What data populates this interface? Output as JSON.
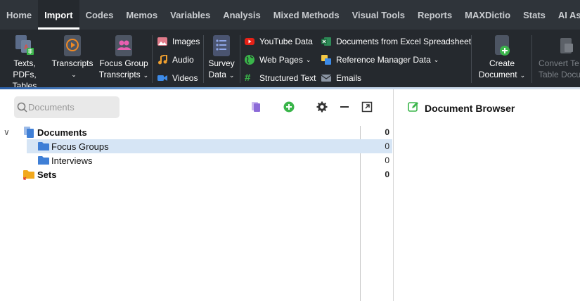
{
  "menu": {
    "tabs": [
      "Home",
      "Import",
      "Codes",
      "Memos",
      "Variables",
      "Analysis",
      "Mixed Methods",
      "Visual Tools",
      "Reports",
      "MAXDictio",
      "Stats",
      "AI Assist"
    ],
    "active": "Import"
  },
  "ribbon": {
    "texts_label_1": "Texts, PDFs,",
    "texts_label_2": "Tables",
    "transcripts_label": "Transcripts",
    "focus_label_1": "Focus Group",
    "focus_label_2": "Transcripts",
    "images": "Images",
    "audio": "Audio",
    "videos": "Videos",
    "survey_label_1": "Survey",
    "survey_label_2": "Data",
    "youtube": "YouTube Data",
    "webpages": "Web Pages",
    "structured": "Structured Text",
    "excel": "Documents from Excel Spreadsheet",
    "refmanager": "Reference Manager Data",
    "emails": "Emails",
    "create_label_1": "Create",
    "create_label_2": "Document",
    "convert_label_1": "Convert Te",
    "convert_label_2": "Table Docu"
  },
  "colors": {
    "menubar": "#2f343a",
    "ribbon": "#25292e",
    "selection": "#d6e5f5",
    "folder_blue": "#3f7fd6",
    "sets_orange": "#f2a91d",
    "add_green": "#3ab54a"
  },
  "documents": {
    "search_placeholder": "Documents",
    "tree": [
      {
        "label": "Documents",
        "count": "0"
      },
      {
        "label": "Focus Groups",
        "count": "0"
      },
      {
        "label": "Interviews",
        "count": "0"
      },
      {
        "label": "Sets",
        "count": "0"
      }
    ]
  },
  "browser": {
    "title": "Document Browser"
  }
}
